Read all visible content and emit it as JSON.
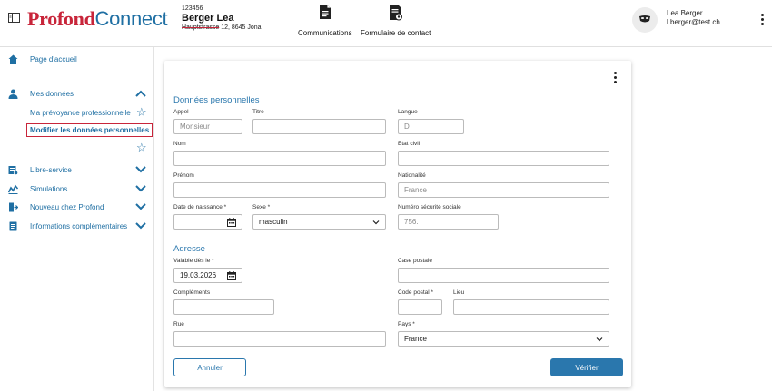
{
  "header": {
    "logo_part1": "Profond",
    "logo_part2": "Connect",
    "policy_number": "123456",
    "policy_name": "Berger Lea",
    "address_street": "Hauptstrasse",
    "address_rest": " 12, 8645 Jona",
    "nav": [
      {
        "label": "Communications",
        "icon": "document-icon"
      },
      {
        "label": "Formulaire de contact",
        "icon": "contact-form-icon"
      }
    ],
    "user_name": "Lea Berger",
    "user_email": "l.berger@test.ch"
  },
  "sidebar": {
    "home": "Page d'accueil",
    "my_data": "Mes données",
    "my_pension": "Ma prévoyance professionnelle",
    "edit_personal": "Modifier les données personnelles",
    "self_service": "Libre-service",
    "simulations": "Simulations",
    "new_at_profond": "Nouveau chez Profond",
    "additional_info": "Informations complémentaires"
  },
  "form": {
    "section_personal": "Données personnelles",
    "appel_label": "Appel",
    "appel_placeholder": "Monsieur",
    "titre_label": "Titre",
    "titre_value": "",
    "langue_label": "Langue",
    "langue_placeholder": "D",
    "nom_label": "Nom",
    "nom_value": "",
    "etat_civil_label": "Etat civil",
    "etat_civil_value": "",
    "prenom_label": "Prénom",
    "prenom_value": "",
    "nationalite_label": "Nationalité",
    "nationalite_placeholder": "France",
    "dob_label": "Date de naissance *",
    "dob_value": "",
    "sexe_label": "Sexe *",
    "sexe_value": "masculin",
    "avs_label": "Numéro sécurité sociale",
    "avs_placeholder": "756.",
    "section_address": "Adresse",
    "valid_from_label": "Valable dès le *",
    "valid_from_value": "19.03.2026",
    "case_postale_label": "Case postale",
    "case_postale_value": "",
    "complements_label": "Compléments",
    "complements_value": "",
    "code_postal_label": "Code postal *",
    "code_postal_value": "",
    "lieu_label": "Lieu",
    "lieu_value": "",
    "rue_label": "Rue",
    "rue_value": "",
    "pays_label": "Pays *",
    "pays_value": "France",
    "cancel_label": "Annuler",
    "verify_label": "Vérifier"
  },
  "colors": {
    "brand_red": "#c8253a",
    "brand_blue": "#1f6fa3",
    "primary_button": "#2a77ad"
  }
}
